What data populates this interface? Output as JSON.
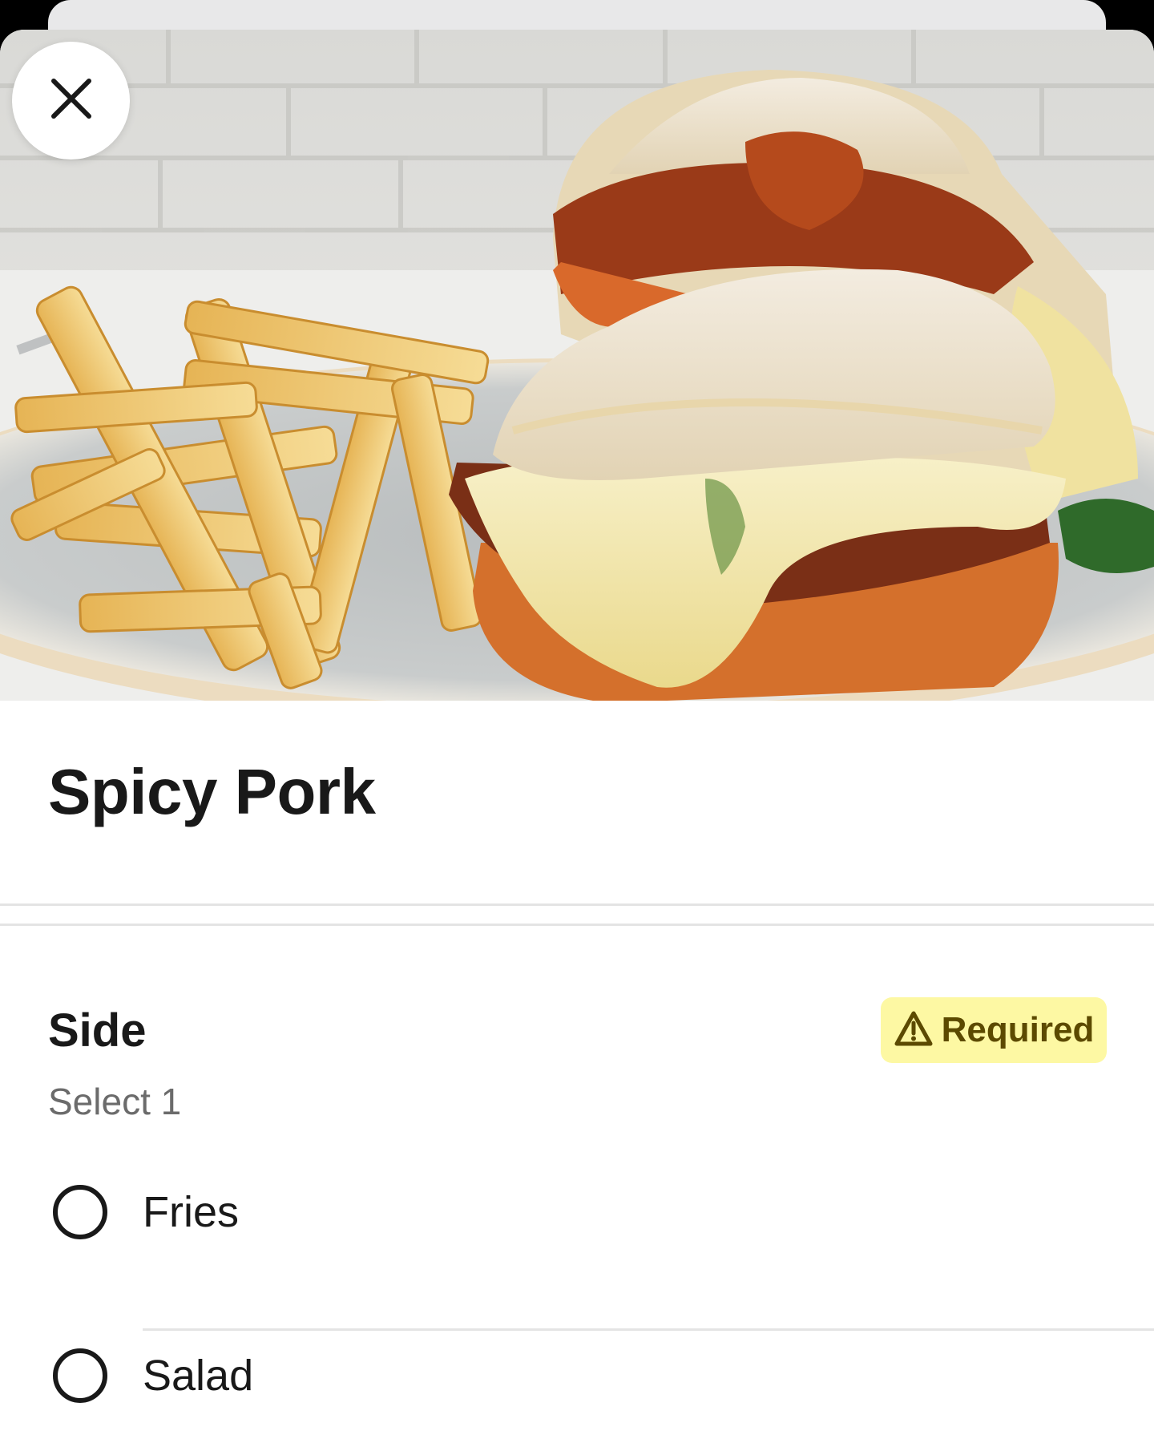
{
  "item": {
    "title": "Spicy Pork"
  },
  "option_group": {
    "title": "Side",
    "subtitle": "Select 1",
    "badge_label": "Required",
    "badge_color": "#fdf8a3",
    "options": [
      {
        "label": "Fries",
        "selected": false
      },
      {
        "label": "Salad",
        "selected": false
      }
    ]
  },
  "icons": {
    "close": "close-icon",
    "warning": "warning-triangle-icon"
  }
}
